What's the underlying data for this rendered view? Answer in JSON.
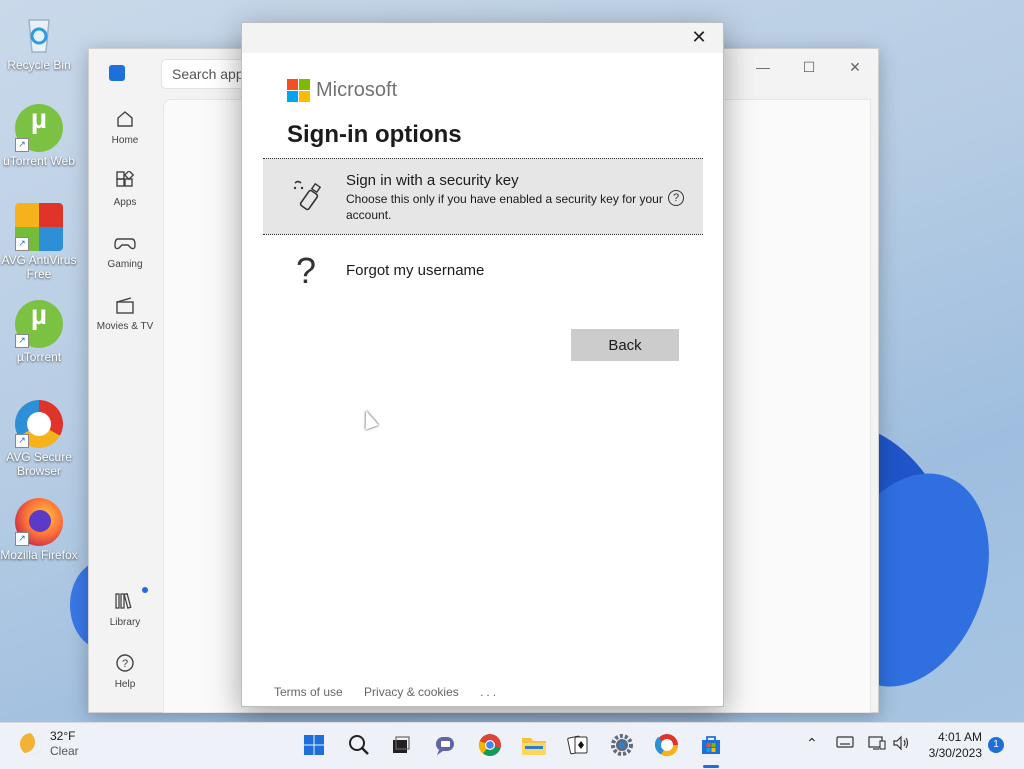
{
  "desktop": {
    "icons": [
      {
        "label": "Recycle Bin"
      },
      {
        "label": "uTorrent Web"
      },
      {
        "label": "AVG AntiVirus Free"
      },
      {
        "label": "µTorrent"
      },
      {
        "label": "AVG Secure Browser"
      },
      {
        "label": "Mozilla Firefox"
      }
    ]
  },
  "store": {
    "search_placeholder": "Search apps",
    "nav": [
      {
        "label": "Home",
        "icon": "home-icon"
      },
      {
        "label": "Apps",
        "icon": "apps-icon"
      },
      {
        "label": "Gaming",
        "icon": "gaming-icon"
      },
      {
        "label": "Movies & TV",
        "icon": "movies-icon"
      },
      {
        "label": "Library",
        "icon": "library-icon"
      },
      {
        "label": "Help",
        "icon": "help-icon"
      }
    ]
  },
  "dialog": {
    "brand": "Microsoft",
    "title": "Sign-in options",
    "option_security_key": {
      "title": "Sign in with a security key",
      "description": "Choose this only if you have enabled a security key for your account."
    },
    "option_forgot_username": {
      "title": "Forgot my username"
    },
    "back_label": "Back",
    "footer": {
      "terms": "Terms of use",
      "privacy": "Privacy & cookies",
      "more": "..."
    }
  },
  "taskbar": {
    "weather": {
      "temp": "32°F",
      "condition": "Clear"
    },
    "clock": {
      "time": "4:01 AM",
      "date": "3/30/2023"
    },
    "notification_count": "1"
  }
}
